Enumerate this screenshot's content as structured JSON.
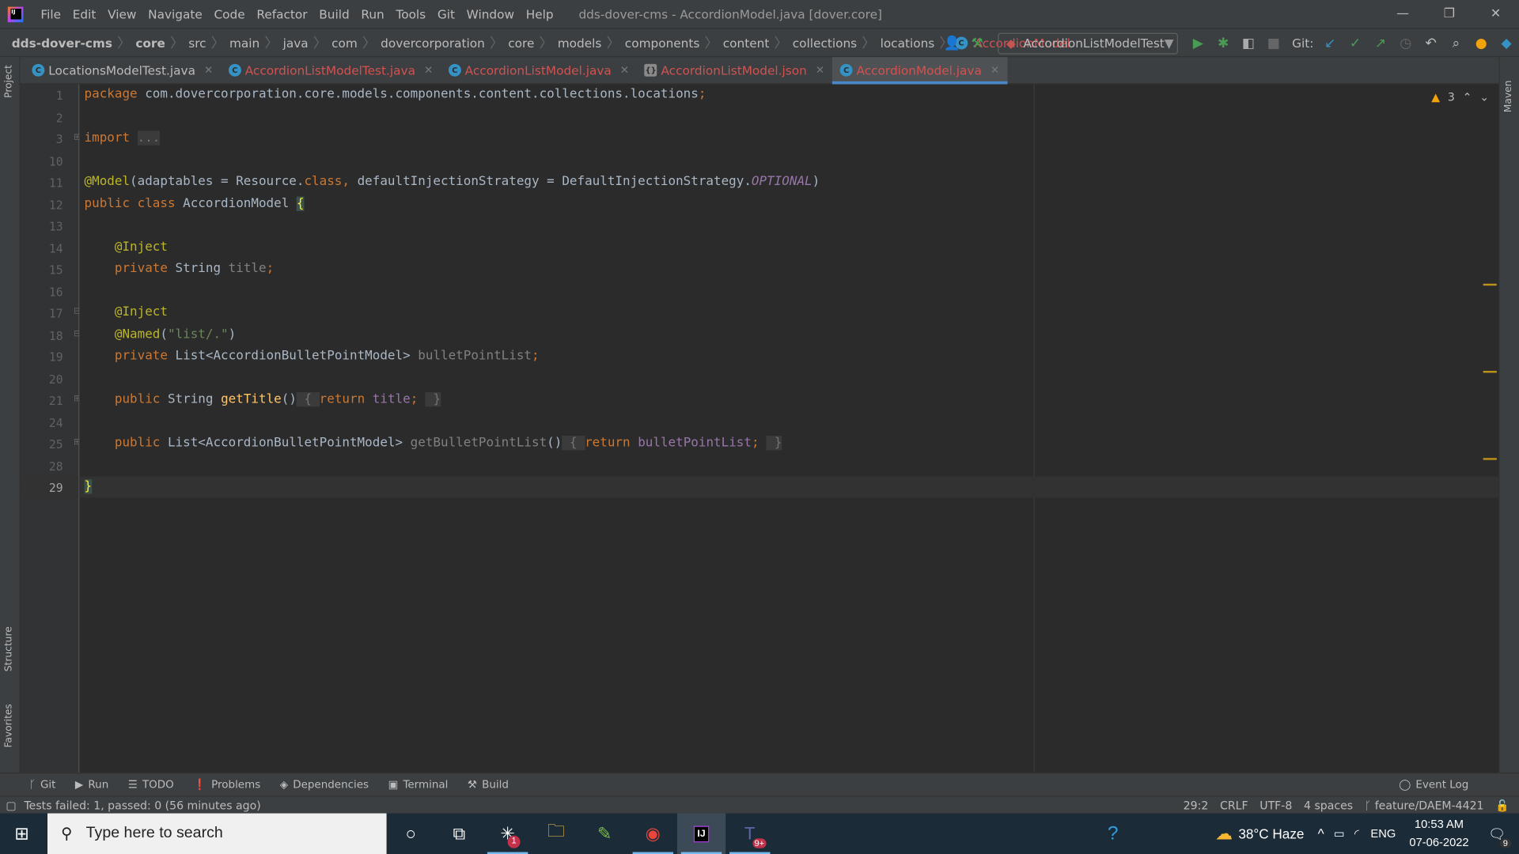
{
  "window": {
    "title": "dds-dover-cms - AccordionModel.java [dover.core]",
    "controls": [
      "—",
      "❐",
      "✕"
    ]
  },
  "menu": [
    "File",
    "Edit",
    "View",
    "Navigate",
    "Code",
    "Refactor",
    "Build",
    "Run",
    "Tools",
    "Git",
    "Window",
    "Help"
  ],
  "breadcrumb": [
    "dds-dover-cms",
    "core",
    "src",
    "main",
    "java",
    "com",
    "dovercorporation",
    "core",
    "models",
    "components",
    "content",
    "collections",
    "locations",
    "AccordionModel"
  ],
  "toolbar": {
    "run_config": "AccordionListModelTest",
    "git_label": "Git:"
  },
  "tabs": [
    {
      "label": "LocationsModelTest.java",
      "error": false,
      "active": false
    },
    {
      "label": "AccordionListModelTest.java",
      "error": true,
      "active": false
    },
    {
      "label": "AccordionListModel.java",
      "error": true,
      "active": false
    },
    {
      "label": "AccordionListModel.json",
      "error": true,
      "active": false
    },
    {
      "label": "AccordionModel.java",
      "error": true,
      "active": true
    }
  ],
  "side": {
    "project": "Project",
    "structure": "Structure",
    "favorites": "Favorites",
    "maven": "Maven"
  },
  "editor": {
    "warnings": "3",
    "current_line": "29",
    "lines": [
      {
        "n": "1",
        "t": [
          [
            "kw",
            "package "
          ],
          [
            "pl",
            "com.dovercorporation.core.models.components.content.collections.locations"
          ],
          [
            "kw",
            ";"
          ]
        ]
      },
      {
        "n": "2",
        "t": []
      },
      {
        "n": "3",
        "fold": "⊞",
        "t": [
          [
            "kw",
            "import "
          ],
          [
            "gr bx",
            "..."
          ]
        ]
      },
      {
        "n": "10",
        "t": []
      },
      {
        "n": "11",
        "t": [
          [
            "an",
            "@Model"
          ],
          [
            "pl",
            "(adaptables = Resource."
          ],
          [
            "kw",
            "class"
          ],
          [
            "kw",
            ", "
          ],
          [
            "pl",
            "defaultInjectionStrategy = DefaultInjectionStrategy."
          ],
          [
            "it",
            "OPTIONAL"
          ],
          [
            "pl",
            ")"
          ]
        ]
      },
      {
        "n": "12",
        "t": [
          [
            "kw",
            "public class "
          ],
          [
            "pl",
            "AccordionModel "
          ],
          [
            "brace",
            "{"
          ]
        ]
      },
      {
        "n": "13",
        "t": []
      },
      {
        "n": "14",
        "t": [
          [
            "pl",
            "    "
          ],
          [
            "an",
            "@Inject"
          ]
        ]
      },
      {
        "n": "15",
        "t": [
          [
            "pl",
            "    "
          ],
          [
            "kw",
            "private "
          ],
          [
            "pl",
            "String "
          ],
          [
            "un",
            "title"
          ],
          [
            "kw",
            ";"
          ]
        ]
      },
      {
        "n": "16",
        "t": []
      },
      {
        "n": "17",
        "fold": "⊟",
        "t": [
          [
            "pl",
            "    "
          ],
          [
            "an",
            "@Inject"
          ]
        ]
      },
      {
        "n": "18",
        "fold": "⊟",
        "t": [
          [
            "pl",
            "    "
          ],
          [
            "an",
            "@Named"
          ],
          [
            "pl",
            "("
          ],
          [
            "st",
            "\"list/.\""
          ],
          [
            "pl",
            ")"
          ]
        ]
      },
      {
        "n": "19",
        "t": [
          [
            "pl",
            "    "
          ],
          [
            "kw",
            "private "
          ],
          [
            "pl",
            "List<AccordionBulletPointModel> "
          ],
          [
            "un",
            "bulletPointList"
          ],
          [
            "kw",
            ";"
          ]
        ]
      },
      {
        "n": "20",
        "t": []
      },
      {
        "n": "21",
        "fold": "⊞",
        "t": [
          [
            "pl",
            "    "
          ],
          [
            "kw",
            "public "
          ],
          [
            "pl",
            "String "
          ],
          [
            "fn",
            "getTitle"
          ],
          [
            "pl",
            "()"
          ],
          [
            "gr bx",
            " { "
          ],
          [
            "kw",
            "return "
          ],
          [
            "fld",
            "title"
          ],
          [
            "kw",
            "; "
          ],
          [
            "gr bx",
            " }"
          ]
        ]
      },
      {
        "n": "24",
        "t": []
      },
      {
        "n": "25",
        "fold": "⊞",
        "t": [
          [
            "pl",
            "    "
          ],
          [
            "kw",
            "public "
          ],
          [
            "pl",
            "List<AccordionBulletPointModel> "
          ],
          [
            "un",
            "getBulletPointList"
          ],
          [
            "pl",
            "()"
          ],
          [
            "gr bx",
            " { "
          ],
          [
            "kw",
            "return "
          ],
          [
            "fld",
            "bulletPointList"
          ],
          [
            "kw",
            "; "
          ],
          [
            "gr bx",
            " }"
          ]
        ]
      },
      {
        "n": "28",
        "t": []
      },
      {
        "n": "29",
        "t": [
          [
            "brace",
            "}"
          ]
        ]
      }
    ]
  },
  "tool_windows": [
    "Git",
    "Run",
    "TODO",
    "Problems",
    "Dependencies",
    "Terminal",
    "Build"
  ],
  "event_log": "Event Log",
  "status": {
    "message": "Tests failed: 1, passed: 0 (56 minutes ago)",
    "position": "29:2",
    "line_sep": "CRLF",
    "encoding": "UTF-8",
    "indent": "4 spaces",
    "branch": "feature/DAEM-4421"
  },
  "taskbar": {
    "search_placeholder": "Type here to search",
    "weather": "38°C  Haze",
    "lang": "ENG",
    "time": "10:53 AM",
    "date": "07-06-2022",
    "notifications": "9",
    "slack_badge": "1",
    "teams_badge": "9+"
  },
  "colors": {
    "accent": "#4a88c7",
    "error_tab": "#d25252",
    "keyword": "#cc7832",
    "annotation": "#bbb529"
  }
}
